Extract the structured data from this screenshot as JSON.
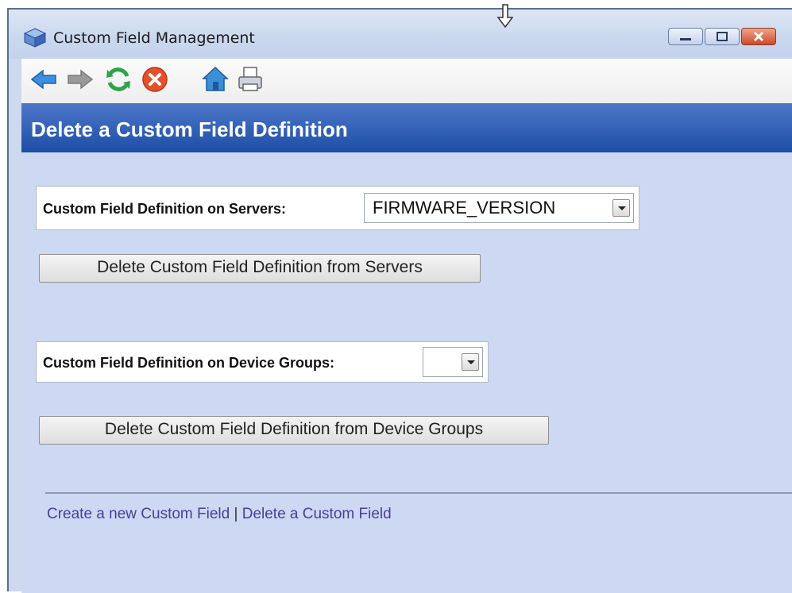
{
  "window": {
    "title": "Custom Field Management",
    "controls": [
      "minimize",
      "maximize",
      "close"
    ]
  },
  "toolbar": {
    "icons": [
      "back-arrow-icon",
      "forward-arrow-icon",
      "refresh-icon",
      "stop-icon",
      "home-icon",
      "print-icon"
    ]
  },
  "header": {
    "title": "Delete a Custom Field Definition"
  },
  "servers_section": {
    "label": "Custom Field Definition on Servers:",
    "selected_value": "FIRMWARE_VERSION",
    "button_label": "Delete Custom Field Definition from Servers"
  },
  "device_groups_section": {
    "label": "Custom Field Definition on Device Groups:",
    "selected_value": "",
    "button_label": "Delete Custom Field Definition from Device Groups"
  },
  "footer": {
    "link_create": "Create a new Custom Field",
    "separator": "|",
    "link_delete": "Delete a Custom Field"
  },
  "colors": {
    "header_bar": "#1d4da7",
    "content_bg": "#cdd9f3",
    "link": "#4a3d9c"
  }
}
